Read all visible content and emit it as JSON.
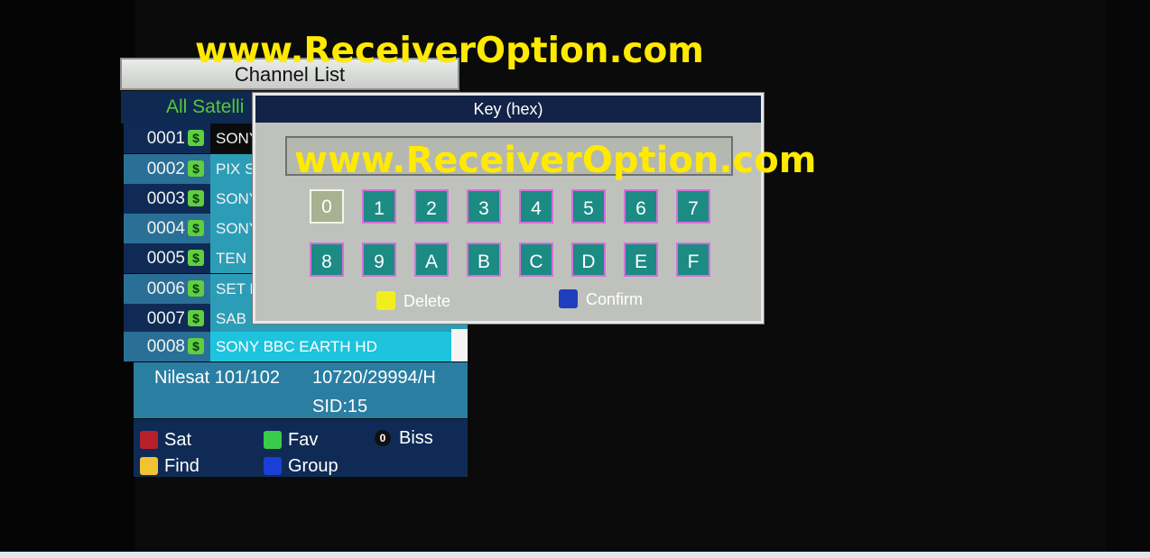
{
  "watermark": "www.ReceiverOption.com",
  "channel_list": {
    "title": "Channel List",
    "satellite_filter": "All Satelli",
    "channels": [
      {
        "number": "0001",
        "name": "SONY"
      },
      {
        "number": "0002",
        "name": "PIX SA"
      },
      {
        "number": "0003",
        "name": "SONY"
      },
      {
        "number": "0004",
        "name": "SONY"
      },
      {
        "number": "0005",
        "name": "TEN F"
      },
      {
        "number": "0006",
        "name": "SET H"
      },
      {
        "number": "0007",
        "name": "SAB H"
      },
      {
        "number": "0008",
        "name": "SONY BBC EARTH HD"
      }
    ],
    "scramble_icon": "$",
    "info": {
      "satellite": "Nilesat 101/102",
      "transponder": "10720/29994/H",
      "sid": "SID:15"
    },
    "legend": {
      "sat": "Sat",
      "fav": "Fav",
      "biss": "Biss",
      "biss_key": "0",
      "find": "Find",
      "group": "Group"
    }
  },
  "key_dialog": {
    "title": "Key (hex)",
    "input_value": "",
    "keys_row1": [
      "0",
      "1",
      "2",
      "3",
      "4",
      "5",
      "6",
      "7"
    ],
    "keys_row2": [
      "8",
      "9",
      "A",
      "B",
      "C",
      "D",
      "E",
      "F"
    ],
    "delete_label": "Delete",
    "confirm_label": "Confirm"
  },
  "colors": {
    "red": "#b8202a",
    "green": "#3bcb4a",
    "yellow": "#f1c232",
    "blue": "#1b3fd6",
    "dialog_yellow": "#f2ee1e",
    "dialog_blue": "#1f3fbf"
  }
}
